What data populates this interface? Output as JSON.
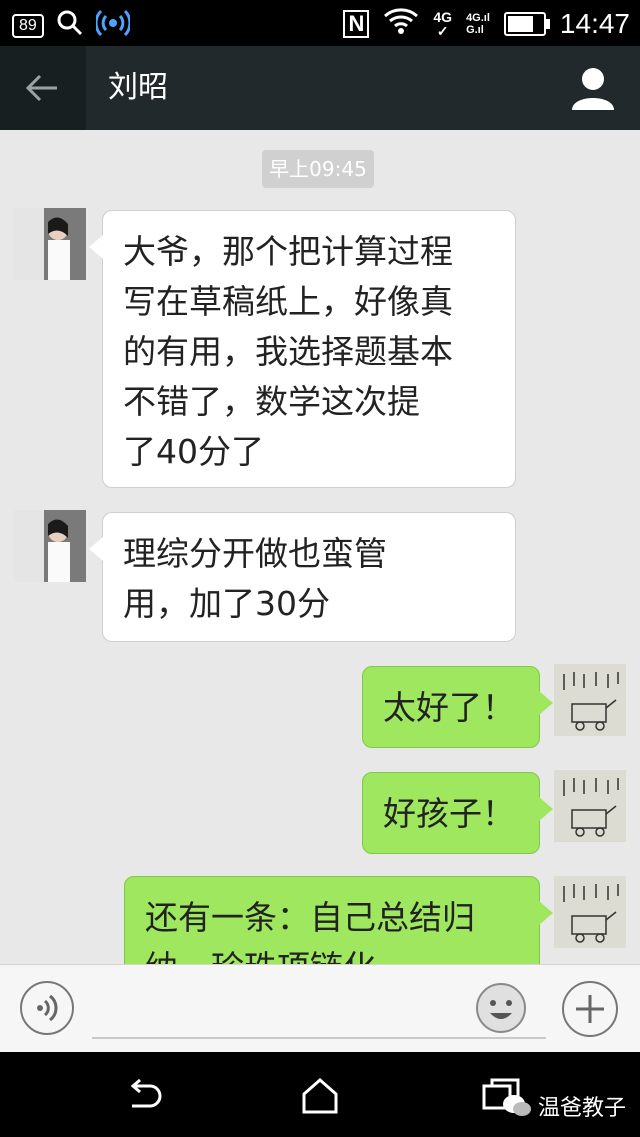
{
  "status_bar": {
    "battery_badge": "89",
    "network_4g": "4G",
    "signal_4g_label": "4G",
    "signal_g_label": "G",
    "battery_level": 0.75,
    "time": "14:47"
  },
  "header": {
    "title": "刘昭"
  },
  "chat": {
    "timestamp": "早上09:45",
    "messages": [
      {
        "side": "left",
        "text": "大爷，那个把计算过程\n写在草稿纸上，好像真\n的有用，我选择题基本\n不错了，数学这次提\n了40分了"
      },
      {
        "side": "left",
        "text": "理综分开做也蛮管\n用，加了30分"
      },
      {
        "side": "right",
        "text": "太好了！"
      },
      {
        "side": "right",
        "text": "好孩子！"
      },
      {
        "side": "right",
        "text": "还有一条：自己总结归\n纳，珍珠项链化"
      }
    ]
  },
  "input_bar": {
    "placeholder": ""
  },
  "nav_bar": {
    "watermark": "温爸教子"
  },
  "colors": {
    "status_bg": "#000000",
    "title_bg": "#21292c",
    "chat_bg": "#e8e8e8",
    "bubble_left": "#ffffff",
    "bubble_right": "#9ee75f"
  }
}
